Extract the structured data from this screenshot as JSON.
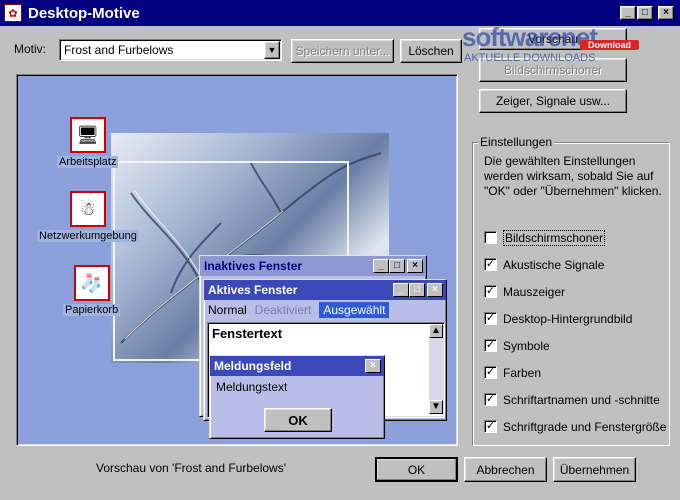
{
  "window": {
    "title": "Desktop-Motive",
    "controls": [
      "_",
      "□",
      "×"
    ]
  },
  "toolbar": {
    "motiv_label": "Motiv:",
    "motiv_value": "Frost and Furbelows",
    "save_label": "Speichern unter...",
    "delete_label": "Löschen"
  },
  "watermark": {
    "line1": "softwarenet",
    "badge": "Download",
    "line2": "AKTUELLE DOWNLOADS"
  },
  "sidebar_buttons": {
    "screensaver": "Bildschirmschoner",
    "pointers": "Zeiger, Signale usw...",
    "partial_top": "Vorschau"
  },
  "settings": {
    "group_label": "Einstellungen",
    "description": "Die gewählten Einstellungen werden wirksam, sobald Sie auf \"OK\" oder \"Übernehmen\" klicken.",
    "items": [
      {
        "label": "Bildschirmschoner",
        "checked": false
      },
      {
        "label": "Akustische Signale",
        "checked": true
      },
      {
        "label": "Mauszeiger",
        "checked": true
      },
      {
        "label": "Desktop-Hintergrundbild",
        "checked": true
      },
      {
        "label": "Symbole",
        "checked": true
      },
      {
        "label": "Farben",
        "checked": true
      },
      {
        "label": "Schriftartnamen und -schnitte",
        "checked": true
      },
      {
        "label": "Schriftgrade und Fenstergröße",
        "checked": true
      }
    ]
  },
  "preview": {
    "icons": [
      {
        "label": "Arbeitsplatz"
      },
      {
        "label": "Netzwerkumgebung"
      },
      {
        "label": "Papierkorb"
      }
    ],
    "inactive_window": {
      "title": "Inaktives Fenster"
    },
    "active_window": {
      "title": "Aktives Fenster",
      "menu_normal": "Normal",
      "menu_disabled": "Deaktiviert",
      "menu_selected": "Ausgewählt",
      "text": "Fenstertext"
    },
    "message_box": {
      "title": "Meldungsfeld",
      "text": "Meldungstext",
      "ok": "OK"
    },
    "caption": "Vorschau von 'Frost and Furbelows'"
  },
  "footer": {
    "ok": "OK",
    "cancel": "Abbrechen",
    "apply": "Übernehmen"
  },
  "colors": {
    "titlebar": "#000080",
    "preview_bg": "#8ca0dc",
    "selected": "#2d5bd6"
  }
}
